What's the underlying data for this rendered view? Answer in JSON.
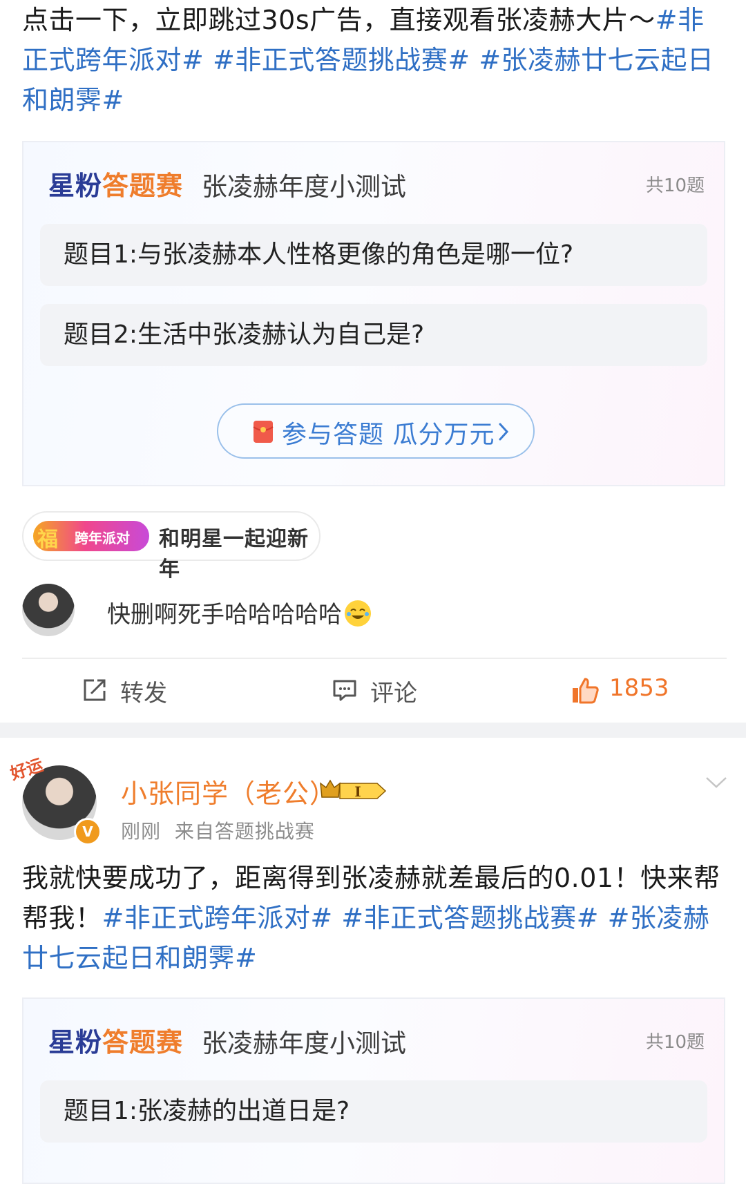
{
  "post1": {
    "text": "点击一下，立即跳过30s广告，直接观看张凌赫大片～",
    "tags": [
      "#非正式跨年派对#",
      "#非正式答题挑战赛#",
      "#张凌赫廿七云起日和朗霁#"
    ]
  },
  "quiz1": {
    "logo_part1": "星粉",
    "logo_part2": "答题赛",
    "title": "张凌赫年度小测试",
    "count": "共10题",
    "questions": [
      "题目1:与张凌赫本人性格更像的角色是哪一位?",
      "题目2:生活中张凌赫认为自己是?"
    ],
    "button_label": "参与答题 瓜分万元",
    "button_icon": "red-packet-icon"
  },
  "topic_chip": {
    "badge_text": "跨年派对",
    "badge_glyph": "福",
    "label": "和明星一起迎新年"
  },
  "hot_comment": {
    "text": "快删啊死手哈哈哈哈哈",
    "emoji": "laughing-tears-emoji"
  },
  "actions": {
    "repost": "转发",
    "comment": "评论",
    "like": "1853"
  },
  "post2": {
    "corner_badge": "好运",
    "user_name": "小张同学（老公）",
    "vip_level": "I",
    "time": "刚刚",
    "source": "来自答题挑战赛",
    "text": "我就快要成功了，距离得到张凌赫就差最后的0.01！快来帮帮我！",
    "tags": [
      "#非正式跨年派对#",
      "#非正式答题挑战赛#",
      "#张凌赫廿七云起日和朗霁#"
    ]
  },
  "quiz2": {
    "logo_part1": "星粉",
    "logo_part2": "答题赛",
    "title": "张凌赫年度小测试",
    "count": "共10题",
    "questions": [
      "题目1:张凌赫的出道日是?"
    ]
  },
  "colors": {
    "link": "#2f6fc4",
    "accent_orange": "#ef7d2c",
    "logo_navy": "#2a3c96",
    "button_blue": "#3b7cd2"
  }
}
